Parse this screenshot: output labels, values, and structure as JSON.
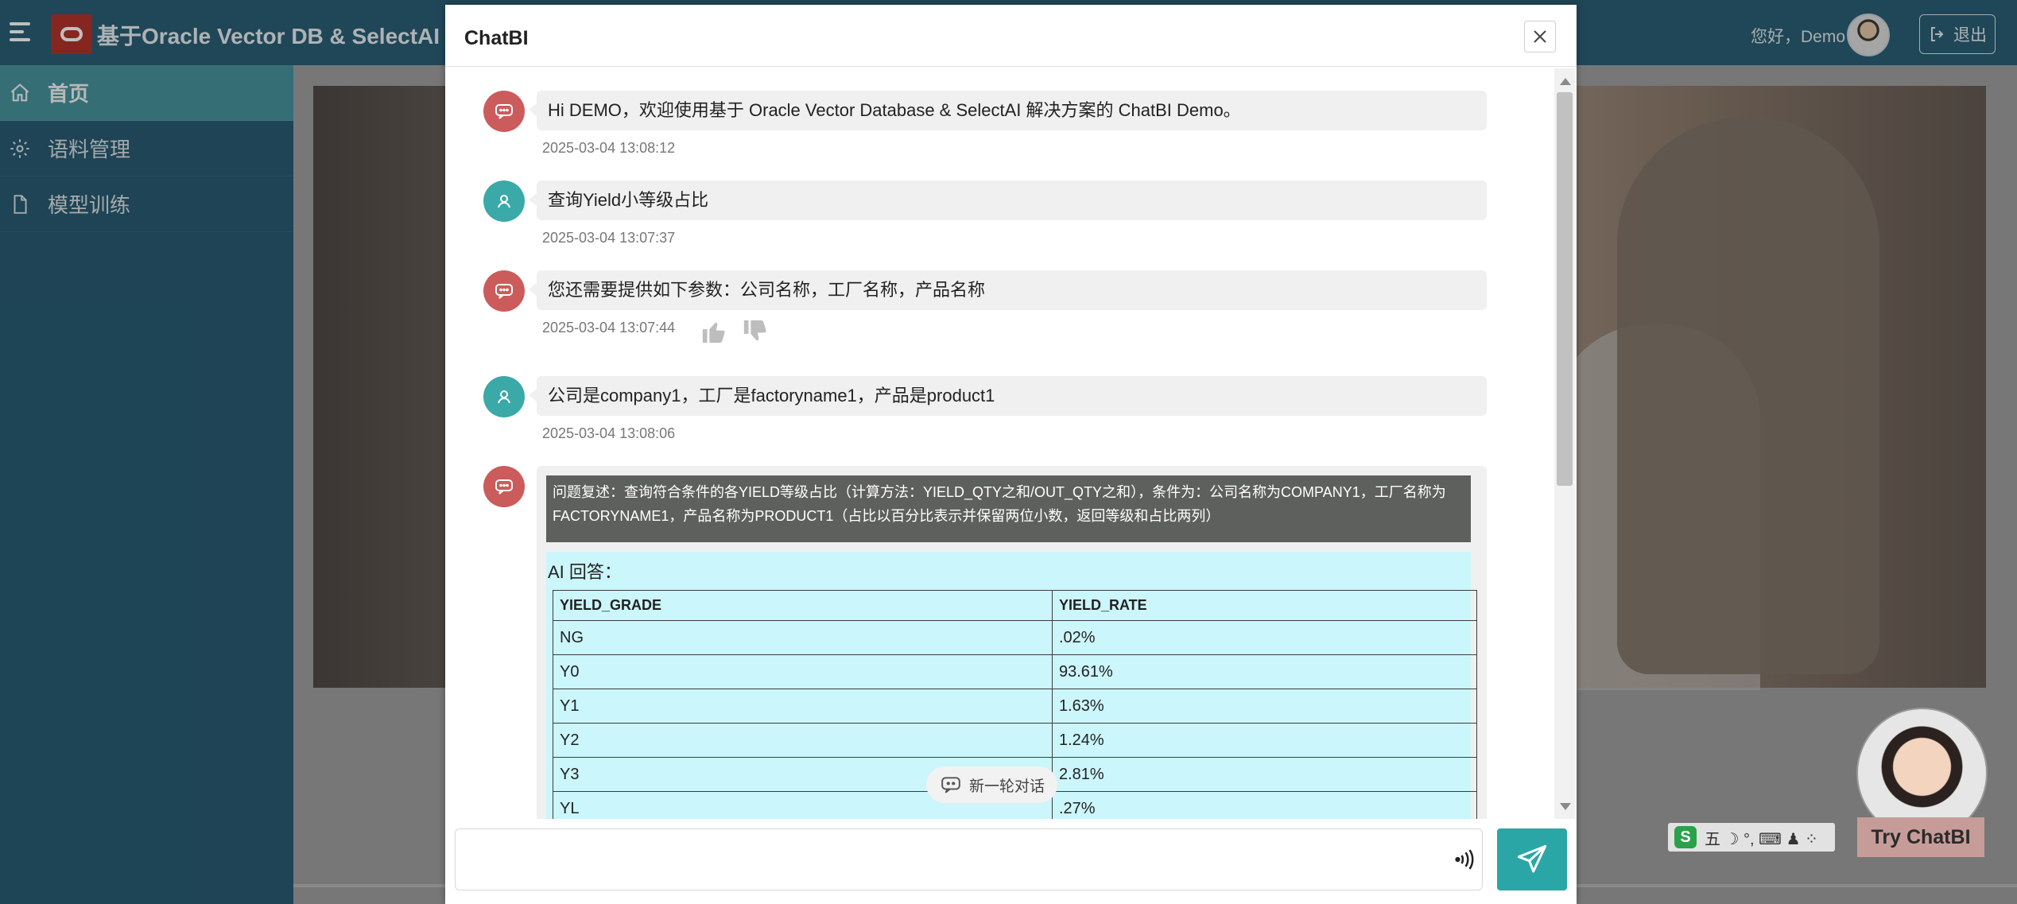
{
  "header": {
    "app_title": "基于Oracle Vector DB & SelectAI 的",
    "greeting": "您好，Demo",
    "logout_label": "退出"
  },
  "sidebar": {
    "items": [
      {
        "label": "首页",
        "icon": "home-icon",
        "active": true
      },
      {
        "label": "语料管理",
        "icon": "gear-icon",
        "active": false
      },
      {
        "label": "模型训练",
        "icon": "document-icon",
        "active": false
      }
    ]
  },
  "dialog": {
    "title": "ChatBI",
    "messages": [
      {
        "role": "bot",
        "text": "Hi DEMO，欢迎使用基于 Oracle Vector Database & SelectAI 解决方案的 ChatBI Demo。",
        "time": "2025-03-04 13:08:12"
      },
      {
        "role": "user",
        "text": "查询Yield小等级占比",
        "time": "2025-03-04 13:07:37"
      },
      {
        "role": "bot",
        "text": "您还需要提供如下参数：公司名称，工厂名称，产品名称",
        "time": "2025-03-04 13:07:44"
      },
      {
        "role": "user",
        "text": "公司是company1，工厂是factoryname1，产品是product1",
        "time": "2025-03-04 13:08:06"
      }
    ],
    "answer": {
      "problem": "问题复述：查询符合条件的各YIELD等级占比（计算方法：YIELD_QTY之和/OUT_QTY之和），条件为：公司名称为COMPANY1，工厂名称为FACTORYNAME1，产品名称为PRODUCT1（占比以百分比表示并保留两位小数，返回等级和占比两列）",
      "ai_label": "AI 回答：",
      "columns": [
        "YIELD_GRADE",
        "YIELD_RATE"
      ],
      "rows": [
        [
          "NG",
          ".02%"
        ],
        [
          "Y0",
          "93.61%"
        ],
        [
          "Y1",
          "1.63%"
        ],
        [
          "Y2",
          "1.24%"
        ],
        [
          "Y3",
          "2.81%"
        ],
        [
          "YL",
          ".27%"
        ]
      ]
    },
    "new_round_label": "新一轮对话",
    "input_placeholder": ""
  },
  "launcher": {
    "label": "Try ChatBI"
  },
  "ime": {
    "text": "五 ☽ °, ⌨ ♟ ⁘"
  },
  "colors": {
    "bot_icon": "#cc5b5b",
    "user_icon": "#3aa9a8",
    "send_button": "#2ba6a6",
    "sidebar_active": "#4a9aa3",
    "answer_bg": "#cbf6fb",
    "problem_bg": "#5e605d"
  }
}
